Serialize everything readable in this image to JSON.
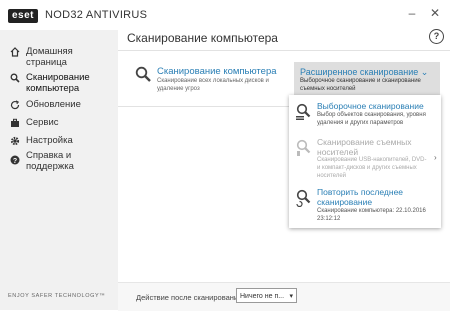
{
  "app": {
    "logo_text": "eset",
    "product": "NOD32 ANTIVIRUS",
    "minimize": "–",
    "close": "✕"
  },
  "sidebar": {
    "items": [
      {
        "label": "Домашняя страница",
        "icon": "home-icon"
      },
      {
        "label": "Сканирование компьютера",
        "icon": "search-icon",
        "active": true
      },
      {
        "label": "Обновление",
        "icon": "refresh-icon"
      },
      {
        "label": "Сервис",
        "icon": "briefcase-icon"
      },
      {
        "label": "Настройка",
        "icon": "gear-icon"
      },
      {
        "label": "Справка и поддержка",
        "icon": "help-icon"
      }
    ],
    "tagline": "ENJOY SAFER TECHNOLOGY™"
  },
  "main": {
    "title": "Сканирование компьютера",
    "help": "?",
    "scan": {
      "label": "Сканирование компьютера",
      "description": "Сканирование всех локальных дисков и удаление угроз"
    },
    "advanced": {
      "label": "Расширенное сканирование",
      "chevron": "⌄",
      "description": "Выборочное сканирование и сканирование съемных носителей"
    },
    "dropdown": [
      {
        "title": "Выборочное сканирование",
        "description": "Выбор объектов сканирования, уровня удаления и других параметров",
        "disabled": false
      },
      {
        "title": "Сканирование съемных носителей",
        "description": "Сканирование USB-накопителей, DVD- и компакт-дисков и других съемных носителей",
        "disabled": true
      },
      {
        "title": "Повторить последнее сканирование",
        "description": "Сканирование компьютера: 22.10.2016 23:12:12",
        "disabled": false
      }
    ],
    "dropdown_chevron": "›"
  },
  "footer": {
    "after_scan_label": "Действие после сканирования",
    "after_scan_value": "Ничего не п...",
    "select_arrow": "▾"
  },
  "colors": {
    "accent": "#2a7fb5",
    "sidebar_bg": "#f1f1f1",
    "highlight_bg": "#dedede"
  }
}
